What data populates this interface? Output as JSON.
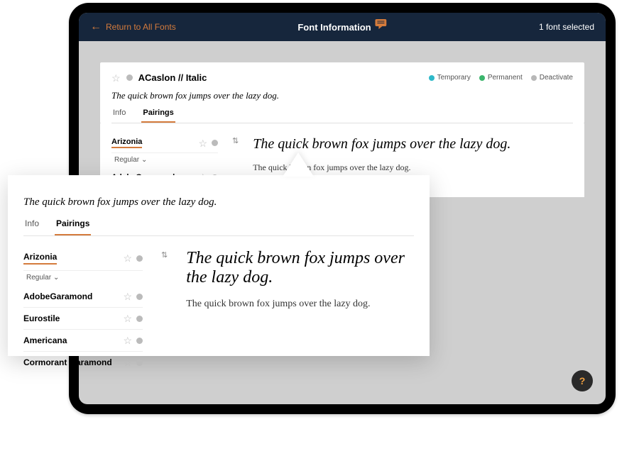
{
  "topbar": {
    "back_label": "Return to All Fonts",
    "title": "Font Information",
    "selected_count": "1 font selected"
  },
  "card": {
    "font_title": "ACaslon // Italic",
    "legend": {
      "temporary": "Temporary",
      "permanent": "Permanent",
      "deactivate": "Deactivate"
    },
    "sample": "The quick brown fox jumps over the lazy dog.",
    "tabs": {
      "info": "Info",
      "pairings": "Pairings"
    }
  },
  "tablet_pairings": {
    "selected_font": "Arizonia",
    "weight_label": "Regular",
    "list": [
      "AdobeGaramond"
    ],
    "preview_large": "The quick brown fox jumps over the lazy dog.",
    "preview_small": "The quick brown fox jumps over the lazy dog."
  },
  "popout": {
    "sample": "The quick brown fox jumps over the lazy dog.",
    "tabs": {
      "info": "Info",
      "pairings": "Pairings"
    },
    "selected_font": "Arizonia",
    "weight_label": "Regular",
    "list": [
      "AdobeGaramond",
      "Eurostile",
      "Americana",
      "Cormorant Garamond"
    ],
    "preview_large": "The quick brown fox jumps over the lazy dog.",
    "preview_small": "The quick brown fox jumps over the lazy dog."
  }
}
